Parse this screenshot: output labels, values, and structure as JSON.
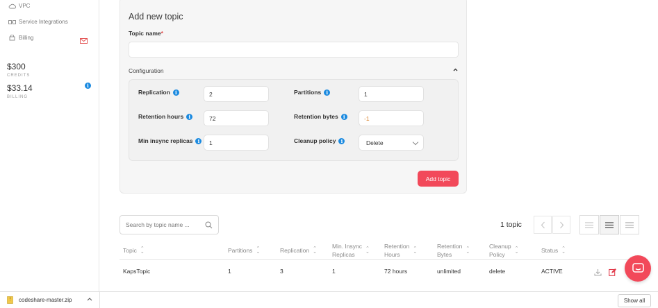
{
  "sidebar": {
    "items": [
      {
        "label": "VPC",
        "icon": "cloud-icon"
      },
      {
        "label": "Service Integrations",
        "icon": "integration-icon"
      },
      {
        "label": "Billing",
        "icon": "billing-icon"
      }
    ],
    "credits": {
      "amount": "$300",
      "label": "CREDITS"
    },
    "billing": {
      "amount": "$33.14",
      "label": "BILLING"
    }
  },
  "form": {
    "title": "Add new topic",
    "topic_name_label": "Topic name",
    "required_mark": "*",
    "topic_name_value": "",
    "configuration_label": "Configuration",
    "replication_label": "Replication",
    "replication_value": "2",
    "partitions_label": "Partitions",
    "partitions_value": "1",
    "retention_hours_label": "Retention hours",
    "retention_hours_value": "72",
    "retention_bytes_label": "Retention bytes",
    "retention_bytes_value": "-1",
    "min_insync_label": "Min insync replicas",
    "min_insync_value": "1",
    "cleanup_label": "Cleanup policy",
    "cleanup_value": "Delete",
    "add_button": "Add topic"
  },
  "toolbar": {
    "search_placeholder": "Search by topic name ...",
    "topic_count": "1 topic"
  },
  "table": {
    "columns": [
      {
        "l1": "Topic",
        "l2": ""
      },
      {
        "l1": "Partitions",
        "l2": ""
      },
      {
        "l1": "Replication",
        "l2": ""
      },
      {
        "l1": "Min. Insync",
        "l2": "Replicas"
      },
      {
        "l1": "Retention",
        "l2": "Hours"
      },
      {
        "l1": "Retention",
        "l2": "Bytes"
      },
      {
        "l1": "Cleanup",
        "l2": "Policy"
      },
      {
        "l1": "Status",
        "l2": ""
      }
    ],
    "rows": [
      [
        "KapsTopic",
        "1",
        "3",
        "1",
        "72 hours",
        "unlimited",
        "delete",
        "ACTIVE"
      ]
    ]
  },
  "downloads": {
    "file_name": "codeshare-master.zip",
    "show_all": "Show all"
  },
  "colors": {
    "accent": "#f2495a",
    "info": "#1b8ae0"
  }
}
